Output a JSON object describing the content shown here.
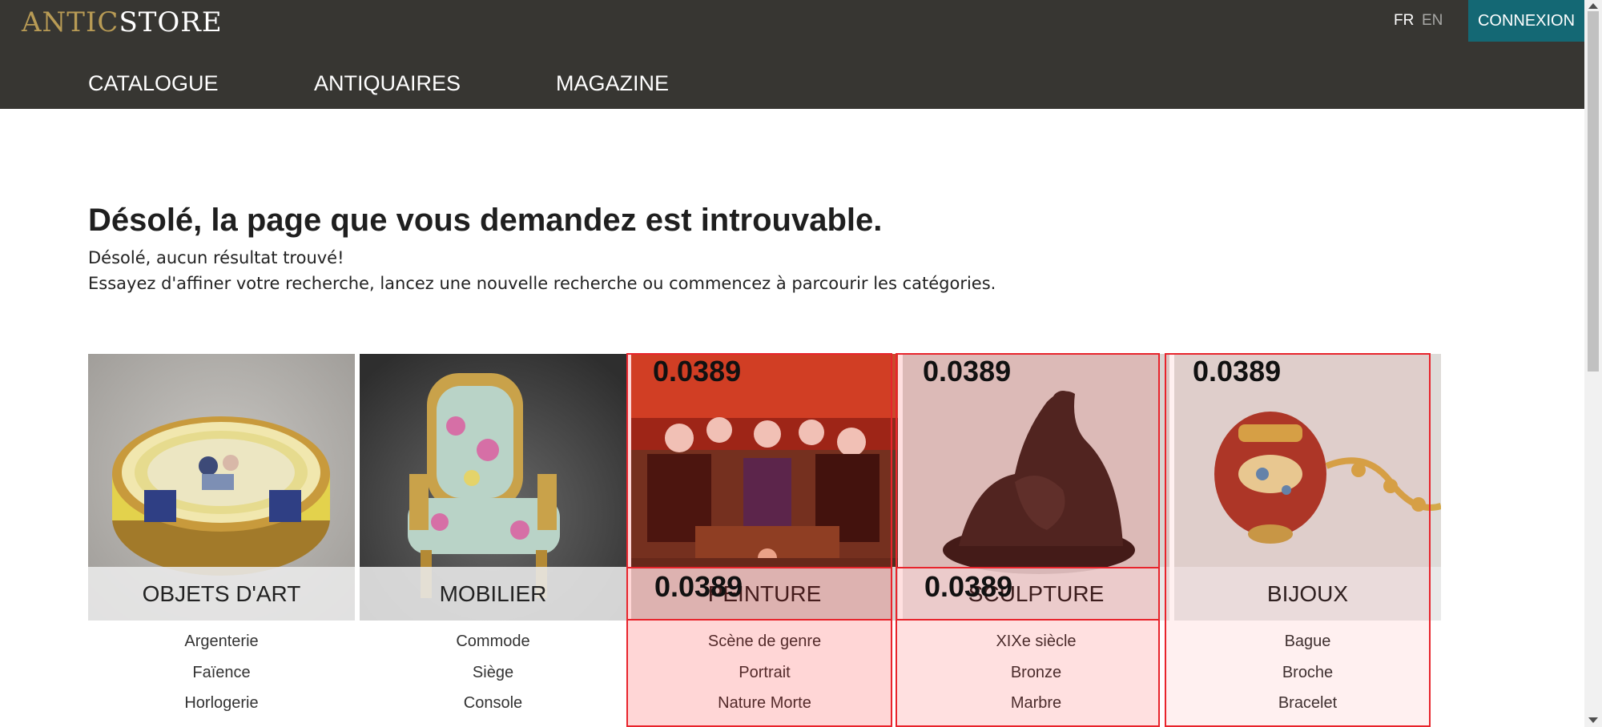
{
  "header": {
    "logo_part1": "ANTIC",
    "logo_part2": "STORE",
    "lang_fr": "FR",
    "lang_en": "EN",
    "login_label": "CONNEXION",
    "nav": [
      "CATALOGUE",
      "ANTIQUAIRES",
      "MAGAZINE"
    ]
  },
  "main": {
    "title": "Désolé, la page que vous demandez est introuvable.",
    "no_result": "Désolé, aucun résultat trouvé!",
    "hint": "Essayez d'affiner votre recherche, lancez une nouvelle recherche ou commencez à parcourir les catégories."
  },
  "categories": [
    {
      "name": "OBJETS D'ART",
      "links": [
        "Argenterie",
        "Faïence",
        "Horlogerie"
      ],
      "icon": "snuff-box-image"
    },
    {
      "name": "MOBILIER",
      "links": [
        "Commode",
        "Siège",
        "Console"
      ],
      "icon": "armchair-image"
    },
    {
      "name": "PEINTURE",
      "links": [
        "Scène de genre",
        "Portrait",
        "Nature Morte"
      ],
      "icon": "genre-painting-image"
    },
    {
      "name": "SCULPTURE",
      "links": [
        "XIXe siècle",
        "Bronze",
        "Marbre"
      ],
      "icon": "bronze-sculpture-image"
    },
    {
      "name": "BIJOUX",
      "links": [
        "Bague",
        "Broche",
        "Bracelet"
      ],
      "icon": "jewel-chatelaine-image"
    }
  ],
  "overlay": {
    "score": "0.0389",
    "color": "#e8242c"
  },
  "colors": {
    "header_bg": "#373632",
    "login_bg": "#146874",
    "logo_gold": "#b89b55"
  }
}
